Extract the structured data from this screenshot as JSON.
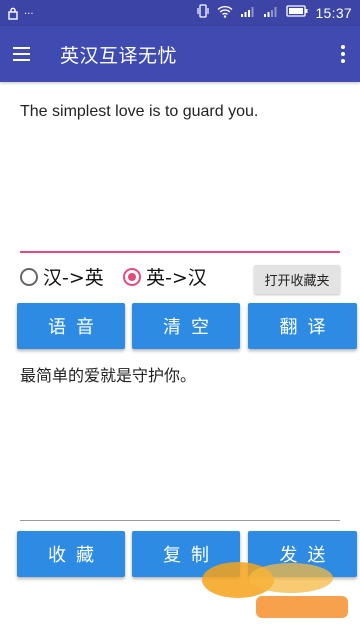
{
  "status_bar": {
    "time": "15:37",
    "left_icons": [
      "lock-icon",
      "more-dots-icon"
    ],
    "right_icons": [
      "vibrate-icon",
      "wifi-icon",
      "signal-icon",
      "signal-icon",
      "battery-icon"
    ]
  },
  "app_bar": {
    "title": "英汉互译无忧",
    "menu_icon": "hamburger-menu-icon",
    "overflow_icon": "overflow-menu-icon"
  },
  "input": {
    "value": "The simplest love is to guard you.",
    "accent_color": "#e8487a"
  },
  "direction": {
    "options": [
      {
        "label": "汉->英",
        "selected": false
      },
      {
        "label": "英->汉",
        "selected": true
      }
    ]
  },
  "favorites_open_button": "打开收藏夹",
  "action_buttons": {
    "voice": "语音",
    "clear": "清空",
    "translate": "翻译"
  },
  "output": {
    "value": "最简单的爱就是守护你。"
  },
  "bottom_buttons": {
    "favorite": "收藏",
    "copy": "复制",
    "send": "发送"
  },
  "colors": {
    "app_bar": "#3f4bb0",
    "status_bar": "#3c45a6",
    "button_blue": "#2d8be4"
  }
}
